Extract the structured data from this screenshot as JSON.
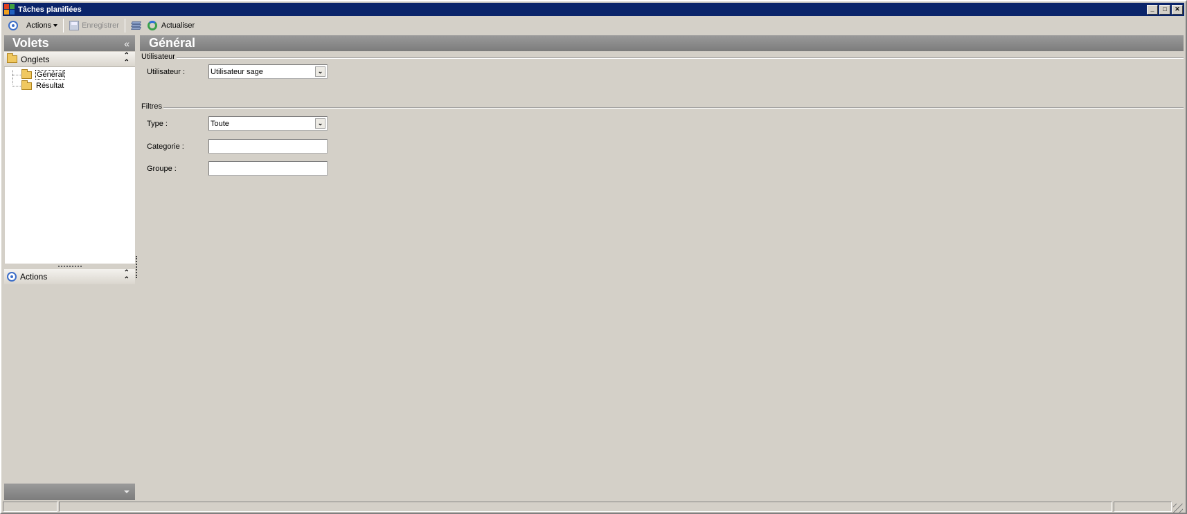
{
  "window": {
    "title": "Tâches planifiées"
  },
  "window_controls": {
    "minimize": "_",
    "maximize": "□",
    "close": "✕"
  },
  "toolbar": {
    "actions_label": "Actions",
    "save_label": "Enregistrer",
    "refresh_label": "Actualiser"
  },
  "left_pane": {
    "header": "Volets",
    "collapse_glyph": "«",
    "onglets": {
      "title": "Onglets",
      "items": [
        {
          "label": "Général",
          "selected": true
        },
        {
          "label": "Résultat",
          "selected": false
        }
      ]
    },
    "actions_panel": {
      "title": "Actions"
    }
  },
  "main": {
    "header": "Général",
    "groups": {
      "utilisateur": {
        "legend": "Utilisateur",
        "user_label": "Utilisateur :",
        "user_value": "Utilisateur sage"
      },
      "filtres": {
        "legend": "Filtres",
        "type_label": "Type :",
        "type_value": "Toute",
        "categorie_label": "Categorie :",
        "categorie_value": "",
        "groupe_label": "Groupe :",
        "groupe_value": ""
      }
    }
  },
  "colors": {
    "titlebar": "#0a246a",
    "pane_header": "#8a8a8a",
    "background": "#d4d0c8",
    "accent_blue": "#3c6ec8"
  }
}
